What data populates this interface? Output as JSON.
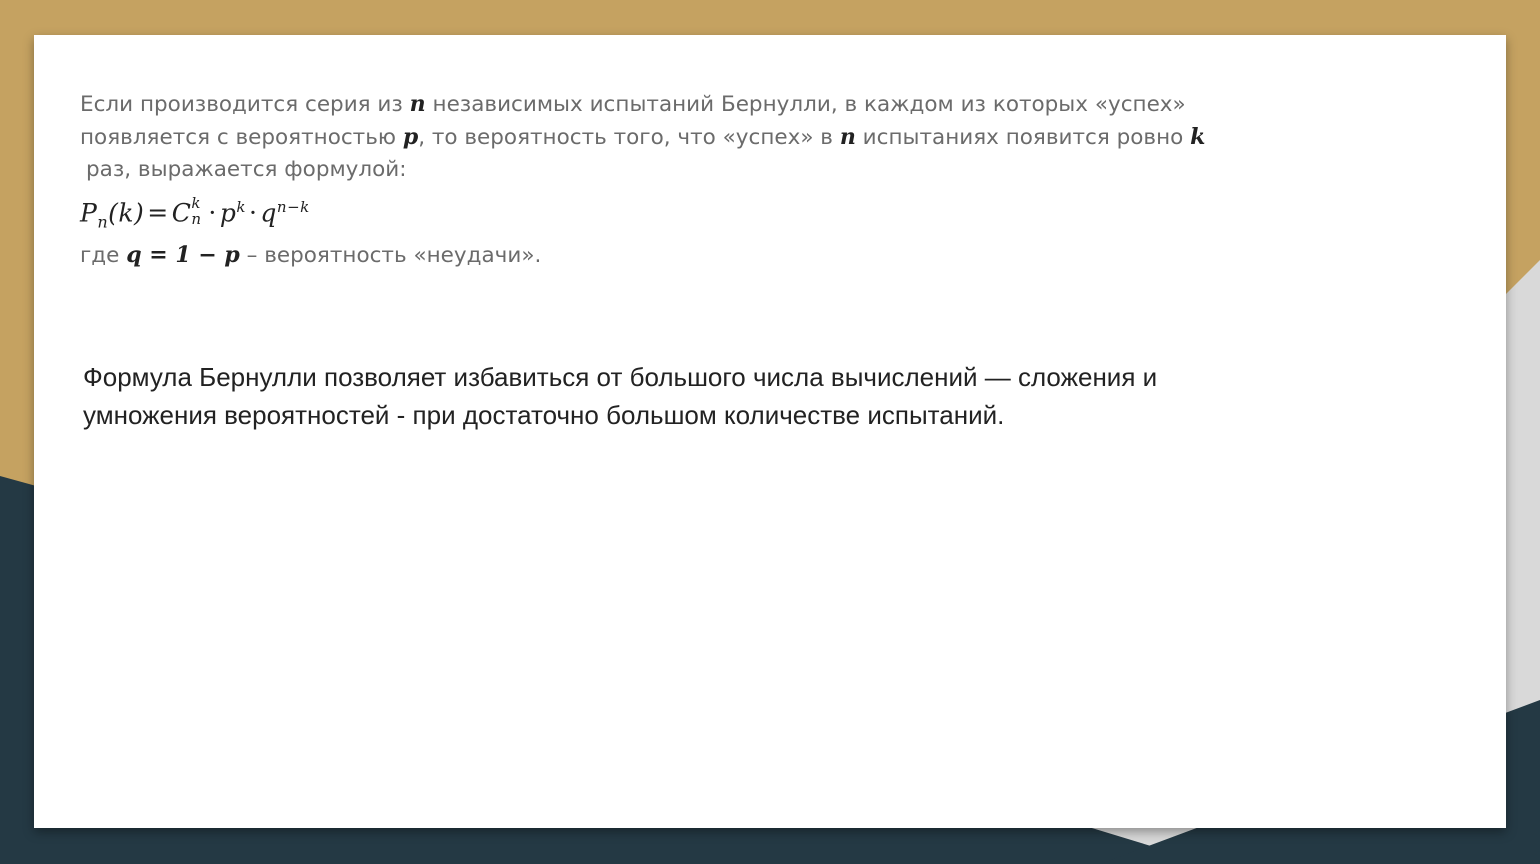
{
  "definition": {
    "line1_a": "Если производится серия из ",
    "var_n": "n",
    "line1_b": " независимых испытаний Бернулли, в каждом из которых «успех»",
    "line2_a": "появляется с вероятностью ",
    "var_p": "p",
    "line2_b": ", то вероятность того, что «успех» в ",
    "line2_c": " испытаниях появится ровно ",
    "var_k": "k",
    "line3": "раз, выражается формулой:"
  },
  "formula": {
    "P": "P",
    "P_sub": "n",
    "arg": "(k)",
    "eq": "=",
    "C": "C",
    "C_sup": "k",
    "C_sub": "n",
    "dot": "·",
    "p": "p",
    "p_sup": "k",
    "q": "q",
    "q_sup": "n−k"
  },
  "where": {
    "prefix": "где ",
    "expr": "q = 1 − p",
    "suffix": " – вероятность «неудачи»."
  },
  "note": {
    "text": "Формула Бернулли позволяет избавиться от большого числа вычислений — сложения и умножения вероятностей - при достаточно большом количестве испытаний."
  },
  "colors": {
    "background_gold": "#c5a261",
    "background_dark": "#243944",
    "background_gray": "#d9d9d9",
    "slide": "#ffffff"
  }
}
